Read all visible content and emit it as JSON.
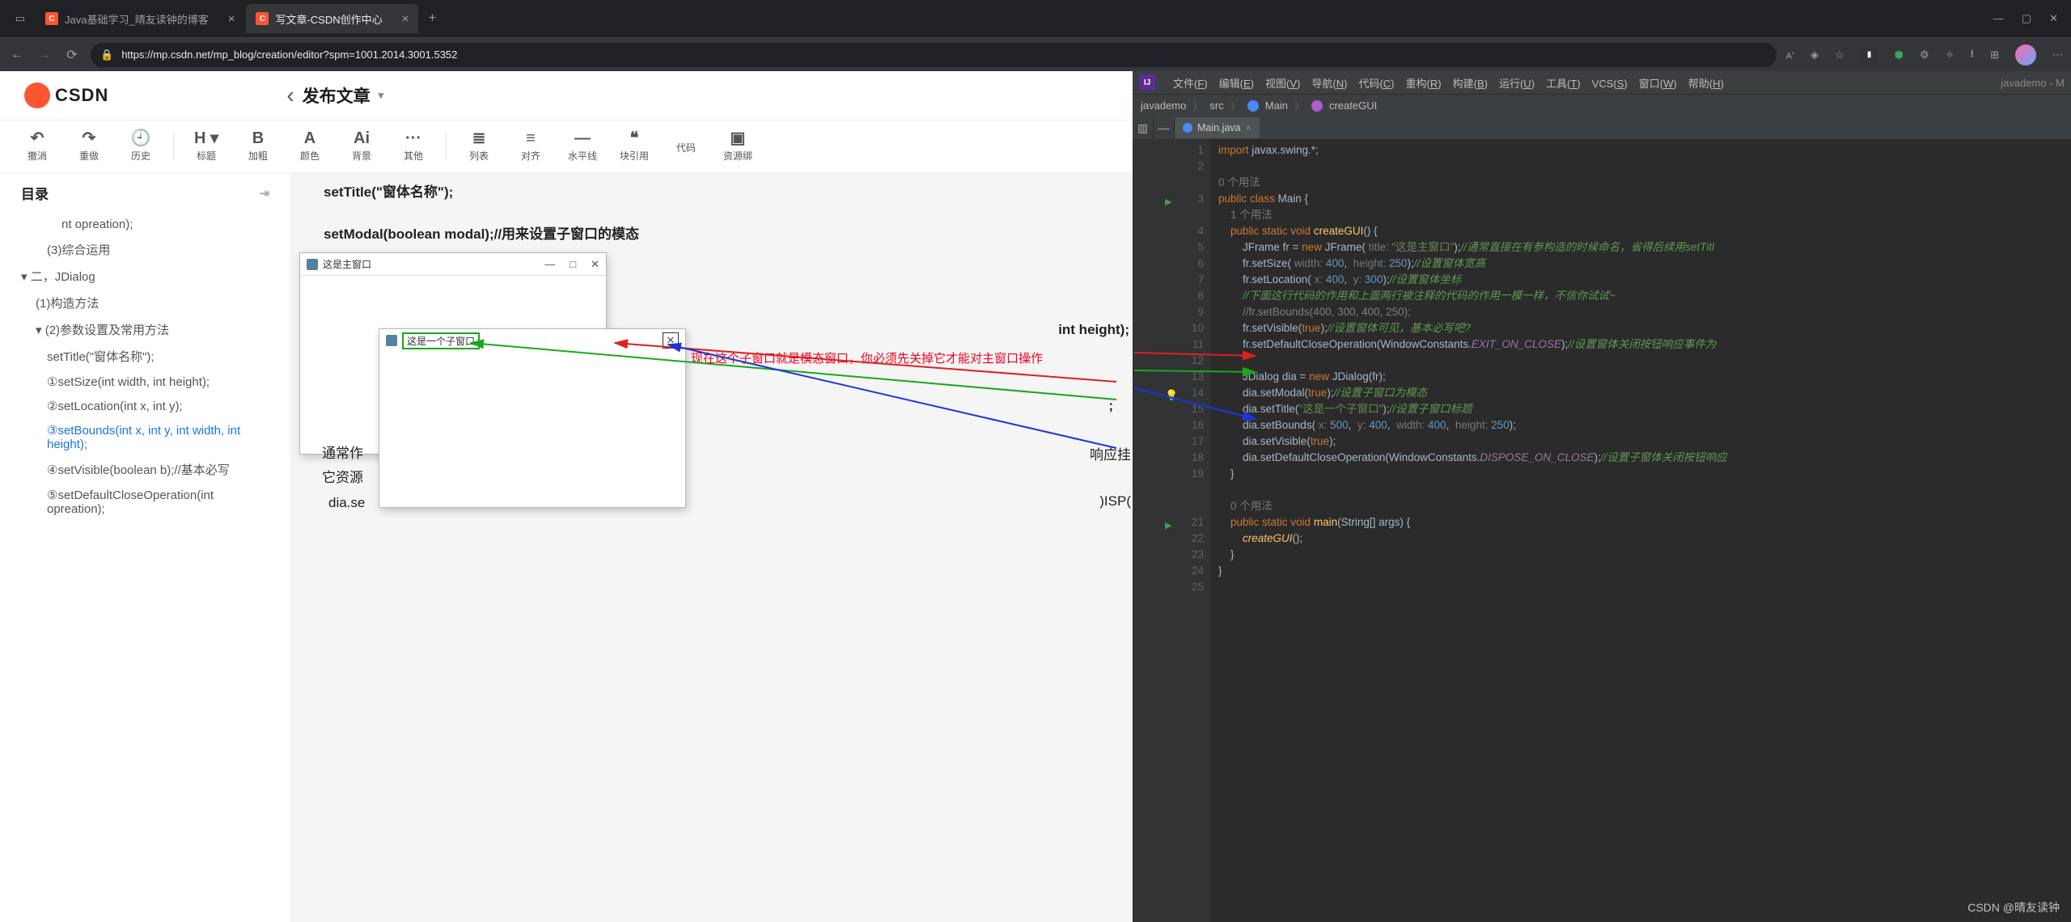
{
  "browser": {
    "tabs": [
      {
        "favicon": "C",
        "title": "Java基础学习_晴友读钟的博客"
      },
      {
        "favicon": "C",
        "title": "写文章-CSDN创作中心"
      }
    ],
    "url": "https://mp.csdn.net/mp_blog/creation/editor?spm=1001.2014.3001.5352"
  },
  "csdn": {
    "logo": "CSDN",
    "back": "‹",
    "page_heading": "发布文章",
    "tools": [
      {
        "ico": "↶",
        "lab": "撤消"
      },
      {
        "ico": "↷",
        "lab": "重做"
      },
      {
        "ico": "🕘",
        "lab": "历史"
      },
      {
        "sep": true
      },
      {
        "ico": "H ▾",
        "lab": "标题"
      },
      {
        "ico": "B",
        "lab": "加粗"
      },
      {
        "ico": "A",
        "lab": "颜色"
      },
      {
        "ico": "Ai",
        "lab": "背景"
      },
      {
        "ico": "···",
        "lab": "其他"
      },
      {
        "sep": true
      },
      {
        "ico": "≣",
        "lab": "列表"
      },
      {
        "ico": "≡",
        "lab": "对齐"
      },
      {
        "ico": "—",
        "lab": "水平线"
      },
      {
        "ico": "❝",
        "lab": "块引用"
      },
      {
        "ico": "</>",
        "lab": "代码"
      },
      {
        "ico": "▣",
        "lab": "资源绑"
      }
    ],
    "toc_title": "目录",
    "toc": [
      {
        "lv": 4,
        "t": "nt opreation);"
      },
      {
        "lv": 3,
        "t": "(3)综合运用"
      },
      {
        "lv": 1,
        "t": "二，JDialog",
        "arrow": "▾"
      },
      {
        "lv": 2,
        "t": "(1)构造方法"
      },
      {
        "lv": 2,
        "t": "(2)参数设置及常用方法",
        "arrow": "▾"
      },
      {
        "lv": 3,
        "t": "setTitle(\"窗体名称\");"
      },
      {
        "lv": 3,
        "t": "①setSize(int width, int height);"
      },
      {
        "lv": 3,
        "t": "②setLocation(int x, int y);"
      },
      {
        "lv": 3,
        "t": "③setBounds(int x, int y, int width, int height);",
        "active": true
      },
      {
        "lv": 3,
        "t": "④setVisible(boolean b);//基本必写"
      },
      {
        "lv": 3,
        "t": "⑤setDefaultCloseOperation(int opreation);"
      }
    ],
    "content_lines": [
      "setTitle(\"窗体名称\");",
      "setModal(boolean modal);//用来设置子窗口的模态",
      "①setSize(int width, int height);"
    ],
    "frag_a": "int height);",
    "frag_b": ";",
    "frag_c": "响应挂",
    "frag_d": ")ISP(",
    "content_below1": "通常作",
    "content_below2": "它资源",
    "content_dia": "dia.se",
    "swing_main_title": "这是主窗口",
    "swing_child_title": "这是一个子窗口",
    "annotation": "现在这个子窗口就是模态窗口，你必须先关掉它才能对主窗口操作"
  },
  "idea": {
    "proj_label": "javademo - M",
    "menu": [
      "文件(F)",
      "编辑(E)",
      "视图(V)",
      "导航(N)",
      "代码(C)",
      "重构(R)",
      "构建(B)",
      "运行(U)",
      "工具(T)",
      "VCS(S)",
      "窗口(W)",
      "帮助(H)"
    ],
    "crumbs": {
      "a": "javademo",
      "b": "src",
      "c": "Main",
      "d": "createGUI"
    },
    "file_tab": "Main.java",
    "usage0": "0 个用法",
    "usage1": "1 个用法"
  },
  "code": {
    "lines": [
      {
        "n": 1,
        "html": "<span class='kw'>import</span> javax.swing.*;"
      },
      {
        "n": 2,
        "html": ""
      },
      {
        "n": "",
        "html": "<span class='hint'>0 个用法</span>"
      },
      {
        "n": 3,
        "run": true,
        "html": "<span class='kw'>public class</span> Main {"
      },
      {
        "n": "",
        "html": "    <span class='hint'>1 个用法</span>"
      },
      {
        "n": 4,
        "html": "    <span class='kw'>public static void</span> <span class='fn'>createGUI</span>() {"
      },
      {
        "n": 5,
        "html": "        JFrame fr = <span class='kw'>new</span> JFrame( <span class='hint'>title:</span> <span class='str'>\"这是主窗口\"</span>);<span class='cmtg'>//通常直接在有参构造的时候命名，省得后续用setTitl</span>"
      },
      {
        "n": 6,
        "html": "        fr.setSize( <span class='hint'>width:</span> <span class='num'>400</span>,  <span class='hint'>height:</span> <span class='num'>250</span>);<span class='cmtg'>//设置窗体宽高</span>"
      },
      {
        "n": 7,
        "html": "        fr.setLocation( <span class='hint'>x:</span> <span class='num'>400</span>,  <span class='hint'>y:</span> <span class='num'>300</span>);<span class='cmtg'>//设置窗体坐标</span>"
      },
      {
        "n": 8,
        "html": "        <span class='cmtg'>//下面这行代码的作用和上面两行被注释的代码的作用一模一样，不信你试试~</span>"
      },
      {
        "n": 9,
        "html": "        <span class='cmt'>//fr.setBounds(400, 300, 400, 250);</span>"
      },
      {
        "n": 10,
        "html": "        fr.setVisible(<span class='kw'>true</span>);<span class='cmtg'>//设置窗体可见，基本必写吧?</span>"
      },
      {
        "n": 11,
        "html": "        fr.setDefaultCloseOperation(WindowConstants.<span class='const-it'>EXIT_ON_CLOSE</span>);<span class='cmtg'>//设置窗体关闭按钮响应事件为</span>"
      },
      {
        "n": 12,
        "html": ""
      },
      {
        "n": 13,
        "html": "        JDialog dia = <span class='kw'>new</span> JDialog(fr);"
      },
      {
        "n": 14,
        "bulb": true,
        "html": "        dia.setModal(<span class='kw'>true</span>);<span class='cmtg'>//设置子窗口为模态</span>"
      },
      {
        "n": 15,
        "html": "        dia.setTitle(<span class='str'>\"这是一个子窗口\"</span>);<span class='cmtg'>//设置子窗口标题</span>"
      },
      {
        "n": 16,
        "html": "        dia.setBounds( <span class='hint'>x:</span> <span class='num'>500</span>,  <span class='hint'>y:</span> <span class='num'>400</span>,  <span class='hint'>width:</span> <span class='num'>400</span>,  <span class='hint'>height:</span> <span class='num'>250</span>);"
      },
      {
        "n": 17,
        "html": "        dia.setVisible(<span class='kw'>true</span>);"
      },
      {
        "n": 18,
        "html": "        dia.setDefaultCloseOperation(WindowConstants.<span class='const-it'>DISPOSE_ON_CLOSE</span>);<span class='cmtg'>//设置子窗体关闭按钮响应</span>"
      },
      {
        "n": 19,
        "html": "    }"
      },
      {
        "n": "",
        "html": ""
      },
      {
        "n": "",
        "html": "    <span class='hint'>0 个用法</span>"
      },
      {
        "n": 21,
        "run": true,
        "html": "    <span class='kw'>public static void</span> <span class='fn'>main</span>(String[] args) {"
      },
      {
        "n": 22,
        "html": "        <span class='fn' style='font-style:italic'>createGUI</span>();"
      },
      {
        "n": 23,
        "html": "    }"
      },
      {
        "n": 24,
        "html": "}"
      },
      {
        "n": 25,
        "html": ""
      }
    ]
  },
  "watermark": "CSDN @晴友读钟"
}
